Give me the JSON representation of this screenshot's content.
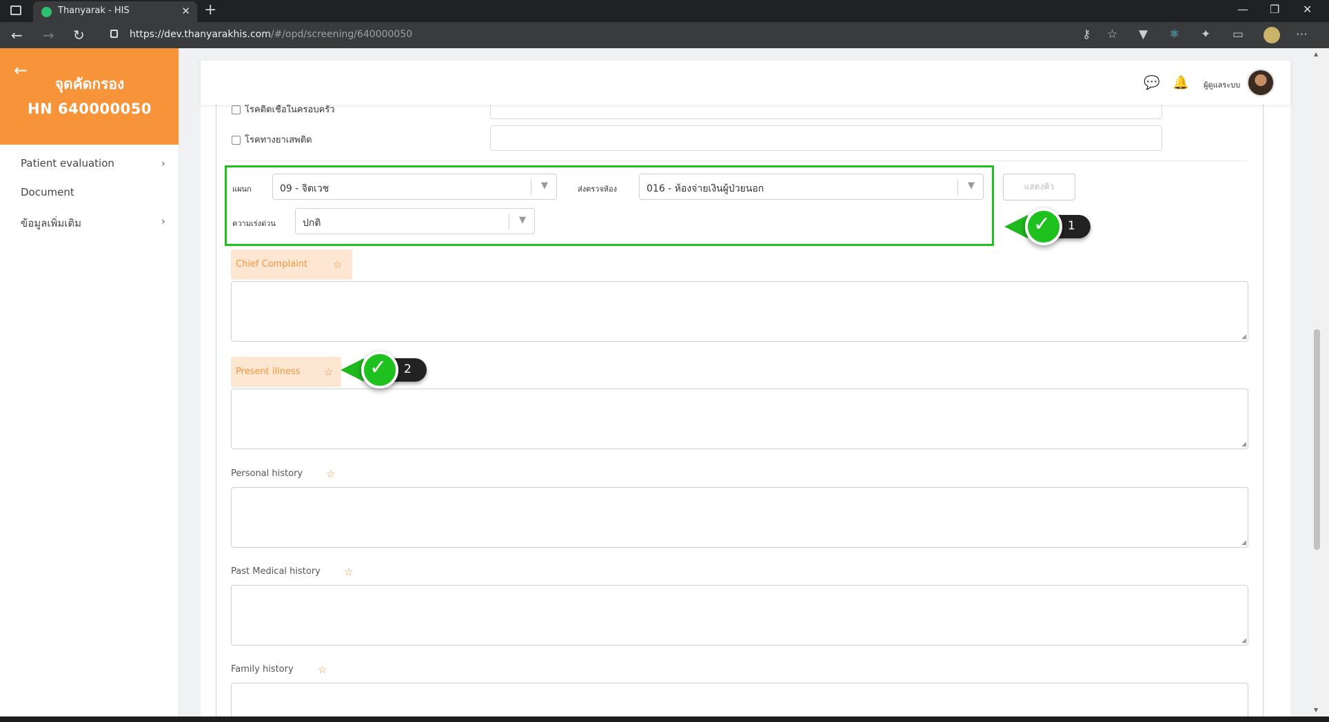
{
  "browser": {
    "tab_title": "Thanyarak - HIS",
    "tab_close": "✕",
    "new_tab": "+",
    "url_host": "https://dev.thanyarakhis.com",
    "url_path": "/#/opd/screening/640000050",
    "window_minimize": "—",
    "window_restore": "❐",
    "window_close": "✕"
  },
  "sidebar": {
    "title": "จุดคัดกรอง",
    "hn": "HN 640000050",
    "items": [
      {
        "label": "Patient evaluation",
        "chevron": "›"
      },
      {
        "label": "Document",
        "chevron": ""
      },
      {
        "label": "ข้อมูลเพิ่มเติม",
        "chevron": "›"
      }
    ]
  },
  "topbar": {
    "user_name": "ผู้ดูแลระบบ"
  },
  "checkboxes": [
    {
      "label": "โรคติดเชื้อในครอบครัว",
      "checked": false
    },
    {
      "label": "โรคทางยาเสพติด",
      "checked": false
    }
  ],
  "routing": {
    "department_label": "แผนก",
    "department_value": "09 - จิตเวช",
    "room_label": "ส่งตรวจห้อง",
    "room_value": "016 - ห้องจ่ายเงินผู้ป่วยนอก",
    "urgency_label": "ความเร่งด่วน",
    "urgency_value": "ปกติ",
    "queue_button": "แสดงคิว"
  },
  "callouts": [
    {
      "number": "1"
    },
    {
      "number": "2"
    }
  ],
  "fields": [
    {
      "label": "Chief Complaint",
      "highlighted": true,
      "value": ""
    },
    {
      "label": "Present illness",
      "highlighted": true,
      "value": ""
    },
    {
      "label": "Personal history",
      "highlighted": false,
      "value": ""
    },
    {
      "label": "Past Medical history",
      "highlighted": false,
      "value": ""
    },
    {
      "label": "Family history",
      "highlighted": false,
      "value": ""
    }
  ],
  "colors": {
    "brand_orange": "#f7943a",
    "highlight_green": "#1fc11f",
    "label_bg": "#fde6d2"
  }
}
